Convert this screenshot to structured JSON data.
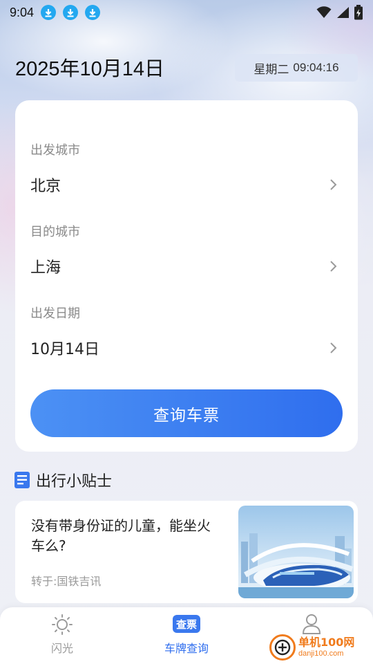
{
  "status_bar": {
    "time": "9:04",
    "download_icons": [
      "download-icon",
      "download-icon",
      "download-icon"
    ],
    "right_icons": [
      "wifi-icon",
      "signal-icon",
      "battery-icon"
    ]
  },
  "header": {
    "date": "2025年10月14日",
    "weekday": "星期二",
    "clock": "09:04:16"
  },
  "form": {
    "departure": {
      "label": "出发城市",
      "value": "北京"
    },
    "destination": {
      "label": "目的城市",
      "value": "上海"
    },
    "date": {
      "label": "出发日期",
      "value": "10月14日"
    },
    "submit_label": "查询车票"
  },
  "tips": {
    "title": "出行小贴士",
    "articles": [
      {
        "title": "没有带身份证的儿童，能坐火车么?",
        "source": "转于:国铁吉讯"
      }
    ]
  },
  "bottom_nav": {
    "items": [
      {
        "label": "闪光",
        "icon": "sun-icon",
        "active": false
      },
      {
        "label": "车牌查询",
        "icon": "ticket-icon",
        "badge": "查票",
        "active": true
      },
      {
        "label": "",
        "icon": "user-icon",
        "active": false
      }
    ]
  },
  "watermark": {
    "main": "单机100网",
    "sub": "danji100.com"
  },
  "colors": {
    "accent": "#2f6eee",
    "button_start": "#4c91f4",
    "download_badge": "#23a8f0",
    "watermark": "#f07b1c"
  }
}
